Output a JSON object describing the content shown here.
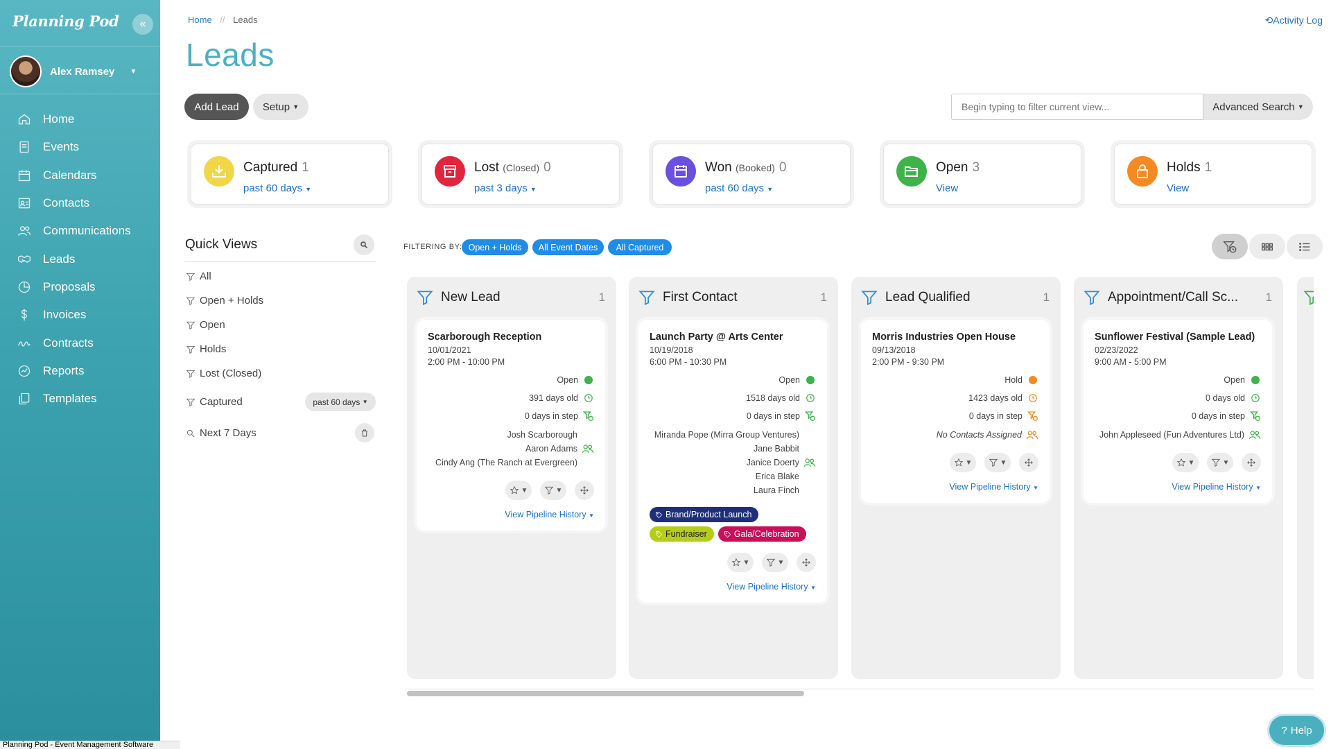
{
  "app": {
    "logo": "Planning Pod",
    "collapse_glyph": "«"
  },
  "user": {
    "name": "Alex Ramsey"
  },
  "nav": [
    {
      "label": "Home",
      "icon": "home-icon"
    },
    {
      "label": "Events",
      "icon": "events-icon"
    },
    {
      "label": "Calendars",
      "icon": "calendar-icon"
    },
    {
      "label": "Contacts",
      "icon": "contacts-icon"
    },
    {
      "label": "Communications",
      "icon": "users-icon"
    },
    {
      "label": "Leads",
      "icon": "handshake-icon"
    },
    {
      "label": "Proposals",
      "icon": "proposals-icon"
    },
    {
      "label": "Invoices",
      "icon": "dollar-icon"
    },
    {
      "label": "Contracts",
      "icon": "signature-icon"
    },
    {
      "label": "Reports",
      "icon": "reports-icon"
    },
    {
      "label": "Templates",
      "icon": "templates-icon"
    }
  ],
  "breadcrumb": {
    "home": "Home",
    "sep": "//",
    "current": "Leads"
  },
  "header": {
    "activity_log": "Activity Log",
    "title": "Leads"
  },
  "toolbar": {
    "add_lead": "Add Lead",
    "setup": "Setup",
    "search_placeholder": "Begin typing to filter current view...",
    "advanced_search": "Advanced Search"
  },
  "stats": [
    {
      "title": "Captured",
      "sub": "",
      "count": "1",
      "link": "past 60 days",
      "dropdown": true,
      "color": "#f1d64a"
    },
    {
      "title": "Lost",
      "sub": "(Closed)",
      "count": "0",
      "link": "past 3 days",
      "dropdown": true,
      "color": "#e0253d"
    },
    {
      "title": "Won",
      "sub": "(Booked)",
      "count": "0",
      "link": "past 60 days",
      "dropdown": true,
      "color": "#6a4fe0"
    },
    {
      "title": "Open",
      "sub": "",
      "count": "3",
      "link": "View",
      "dropdown": false,
      "color": "#3db34a"
    },
    {
      "title": "Holds",
      "sub": "",
      "count": "1",
      "link": "View",
      "dropdown": false,
      "color": "#f58a24"
    }
  ],
  "quick_views": {
    "title": "Quick Views",
    "items": [
      "All",
      "Open + Holds",
      "Open",
      "Holds",
      "Lost (Closed)",
      "Captured",
      "Next 7 Days"
    ],
    "captured_range": "past 60 days"
  },
  "filtering": {
    "label": "FILTERING BY:",
    "pills": [
      "Open + Holds",
      "All Event Dates",
      "All Captured"
    ]
  },
  "columns": [
    {
      "title": "New Lead",
      "count": "1",
      "card": {
        "title": "Scarborough Reception",
        "date": "10/01/2021",
        "time": "2:00 PM - 10:00 PM",
        "status": "Open",
        "status_color": "#3db34a",
        "age": "391 days old",
        "age_color": "#3db34a",
        "step": "0 days in step",
        "step_color": "#3db34a",
        "contacts": [
          "Josh Scarborough",
          "Aaron Adams",
          "Cindy Ang (The Ranch at Evergreen)"
        ],
        "contacts_color": "#3db34a",
        "tags": [],
        "pipeline": "View Pipeline History"
      }
    },
    {
      "title": "First Contact",
      "count": "1",
      "card": {
        "title": "Launch Party @ Arts Center",
        "date": "10/19/2018",
        "time": "6:00 PM - 10:30 PM",
        "status": "Open",
        "status_color": "#3db34a",
        "age": "1518 days old",
        "age_color": "#3db34a",
        "step": "0 days in step",
        "step_color": "#3db34a",
        "contacts": [
          "Miranda Pope (Mirra Group Ventures)",
          "Jane Babbit",
          "Janice Doerty",
          "Erica Blake",
          "Laura Finch"
        ],
        "contacts_color": "#3db34a",
        "tags": [
          {
            "label": "Brand/Product Launch",
            "color": "#1e2f7a"
          },
          {
            "label": "Fundraiser",
            "color": "#b5cc18",
            "text": "#222"
          },
          {
            "label": "Gala/Celebration",
            "color": "#c8105a"
          }
        ],
        "pipeline": "View Pipeline History"
      }
    },
    {
      "title": "Lead Qualified",
      "count": "1",
      "card": {
        "title": "Morris Industries Open House",
        "date": "09/13/2018",
        "time": "2:00 PM - 9:30 PM",
        "status": "Hold",
        "status_color": "#f58a24",
        "age": "1423 days old",
        "age_color": "#f58a24",
        "step": "0 days in step",
        "step_color": "#f58a24",
        "contacts": [],
        "no_contacts": "No Contacts Assigned",
        "contacts_color": "#f58a24",
        "tags": [],
        "pipeline": "View Pipeline History"
      }
    },
    {
      "title": "Appointment/Call Sc...",
      "count": "1",
      "card": {
        "title": "Sunflower Festival (Sample Lead)",
        "date": "02/23/2022",
        "time": "9:00 AM - 5:00 PM",
        "status": "Open",
        "status_color": "#3db34a",
        "age": "0 days old",
        "age_color": "#3db34a",
        "step": "0 days in step",
        "step_color": "#3db34a",
        "contacts": [
          "John Appleseed (Fun Adventures Ltd)"
        ],
        "contacts_color": "#3db34a",
        "tags": [],
        "pipeline": "View Pipeline History"
      }
    }
  ],
  "help": "Help",
  "statusbar": "Planning Pod - Event Management Software"
}
